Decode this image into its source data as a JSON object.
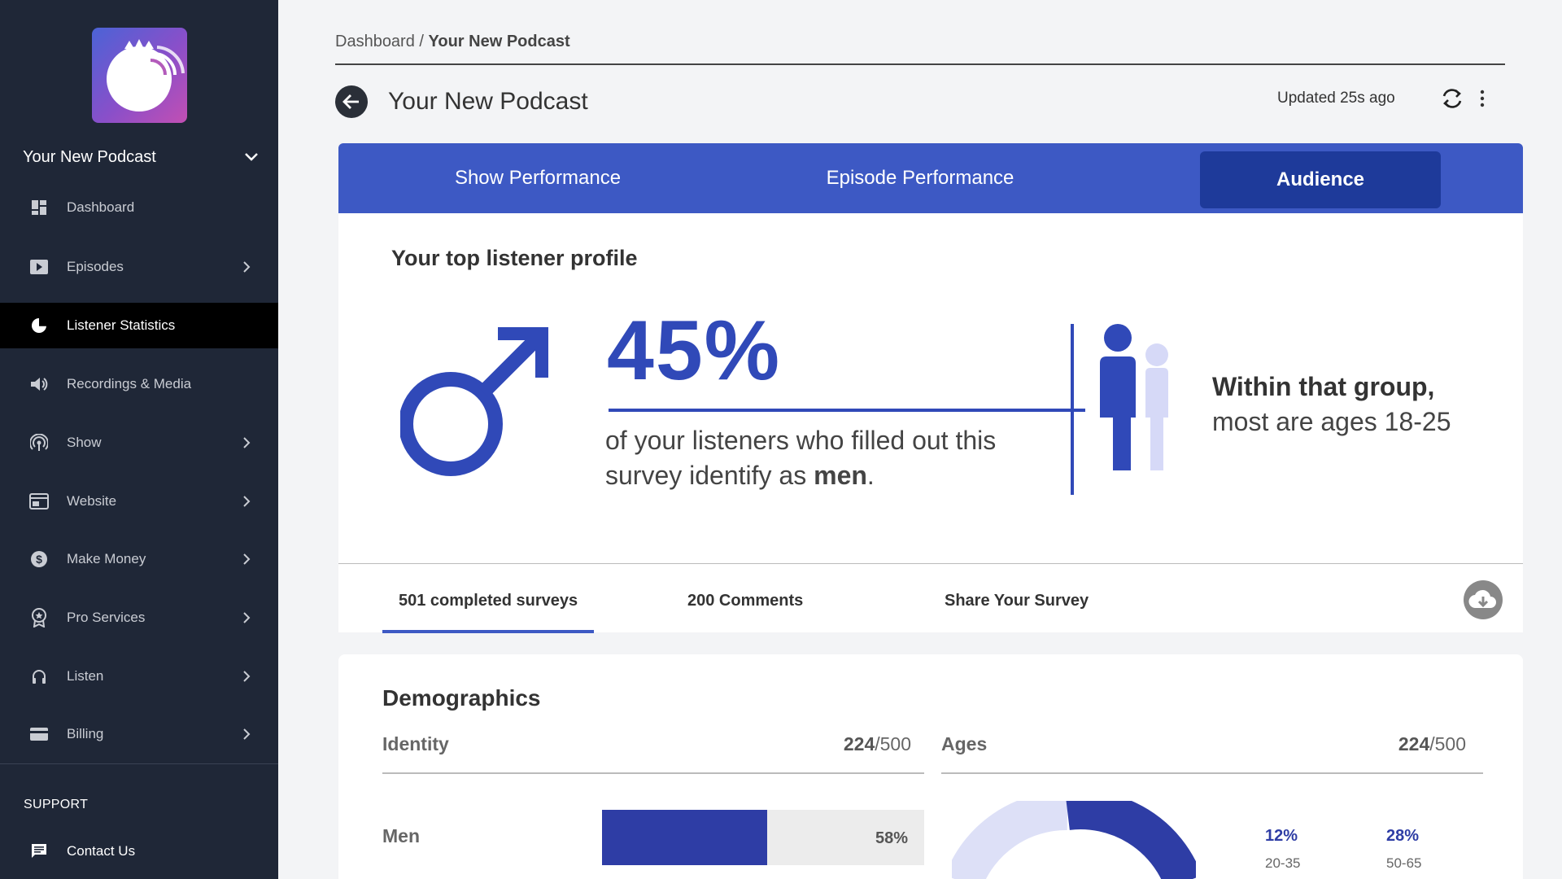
{
  "sidebar": {
    "podcast_name": "Your New Podcast",
    "items": [
      {
        "label": "Dashboard",
        "icon": "dashboard-icon",
        "chevron": false
      },
      {
        "label": "Episodes",
        "icon": "play-icon",
        "chevron": true
      },
      {
        "label": "Listener Statistics",
        "icon": "pie-chart-icon",
        "chevron": false,
        "active": true
      },
      {
        "label": "Recordings & Media",
        "icon": "speaker-icon",
        "chevron": false
      },
      {
        "label": "Show",
        "icon": "broadcast-icon",
        "chevron": true
      },
      {
        "label": "Website",
        "icon": "website-icon",
        "chevron": true
      },
      {
        "label": "Make Money",
        "icon": "dollar-icon",
        "chevron": true
      },
      {
        "label": "Pro Services",
        "icon": "award-icon",
        "chevron": true
      },
      {
        "label": "Listen",
        "icon": "headphones-icon",
        "chevron": true
      },
      {
        "label": "Billing",
        "icon": "credit-card-icon",
        "chevron": true
      }
    ],
    "support_heading": "SUPPORT",
    "contact_label": "Contact Us"
  },
  "header": {
    "breadcrumb_root": "Dashboard",
    "breadcrumb_sep": " / ",
    "breadcrumb_current": "Your New Podcast",
    "title": "Your New Podcast",
    "updated": "Updated 25s ago"
  },
  "tabs": [
    {
      "label": "Show Performance"
    },
    {
      "label": "Episode Performance"
    },
    {
      "label": "Audience",
      "active": true
    }
  ],
  "profile": {
    "heading": "Your top listener profile",
    "percent": "45%",
    "desc_prefix": "of your listeners who filled out this survey identify as ",
    "desc_emph": "men",
    "desc_suffix": ".",
    "within_bold": "Within that group,",
    "within_rest": "most are ages 18-25",
    "colors": {
      "primary": "#3049b8",
      "secondary": "#d6d9f7"
    }
  },
  "subtabs": {
    "surveys": "501 completed surveys",
    "comments": "200 Comments",
    "share": "Share Your Survey"
  },
  "demographics": {
    "title": "Demographics",
    "identity": {
      "heading": "Identity",
      "count": "224",
      "total": "/500"
    },
    "ages": {
      "heading": "Ages",
      "count": "224",
      "total": "/500"
    },
    "identity_rows": [
      {
        "label": "Men",
        "value": 0.58,
        "pct_label": "58%"
      }
    ],
    "age_stats": [
      {
        "value": "12%",
        "label": "20-35"
      },
      {
        "value": "28%",
        "label": "50-65"
      }
    ],
    "donut_colors": {
      "primary": "#2e3da5",
      "secondary": "#dde0f7"
    }
  }
}
